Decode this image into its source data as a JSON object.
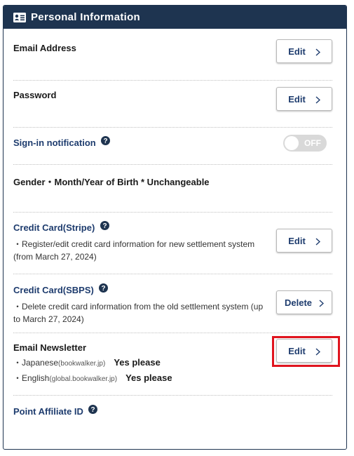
{
  "header": {
    "title": "Personal Information",
    "icon": "id-card-icon"
  },
  "rows": {
    "email": {
      "label": "Email Address",
      "button": "Edit"
    },
    "password": {
      "label": "Password",
      "button": "Edit"
    },
    "signin": {
      "label": "Sign-in notification",
      "toggle": "OFF"
    },
    "gender": {
      "label": "Gender・Month/Year of Birth * Unchangeable"
    },
    "stripe": {
      "label": "Credit Card(Stripe)",
      "desc": "・Register/edit credit card information for new settlement system　(from March 27, 2024)",
      "button": "Edit"
    },
    "sbps": {
      "label": "Credit Card(SBPS)",
      "desc": "・Delete credit card information from the old settlement system (up to March 27, 2024)",
      "button": "Delete"
    },
    "newsletter": {
      "label": "Email Newsletter",
      "button": "Edit",
      "lines": [
        {
          "lang": "・Japanese",
          "site": "(bookwalker.jp)",
          "value": "Yes please"
        },
        {
          "lang": "・English",
          "site": "(global.bookwalker.jp)",
          "value": "Yes please"
        }
      ]
    },
    "affiliate": {
      "label": "Point Affiliate ID"
    }
  },
  "colors": {
    "header_bg": "#1e3450",
    "link": "#1e3c6e",
    "highlight": "#e0141e",
    "toggle_off": "#d9d9d9"
  }
}
